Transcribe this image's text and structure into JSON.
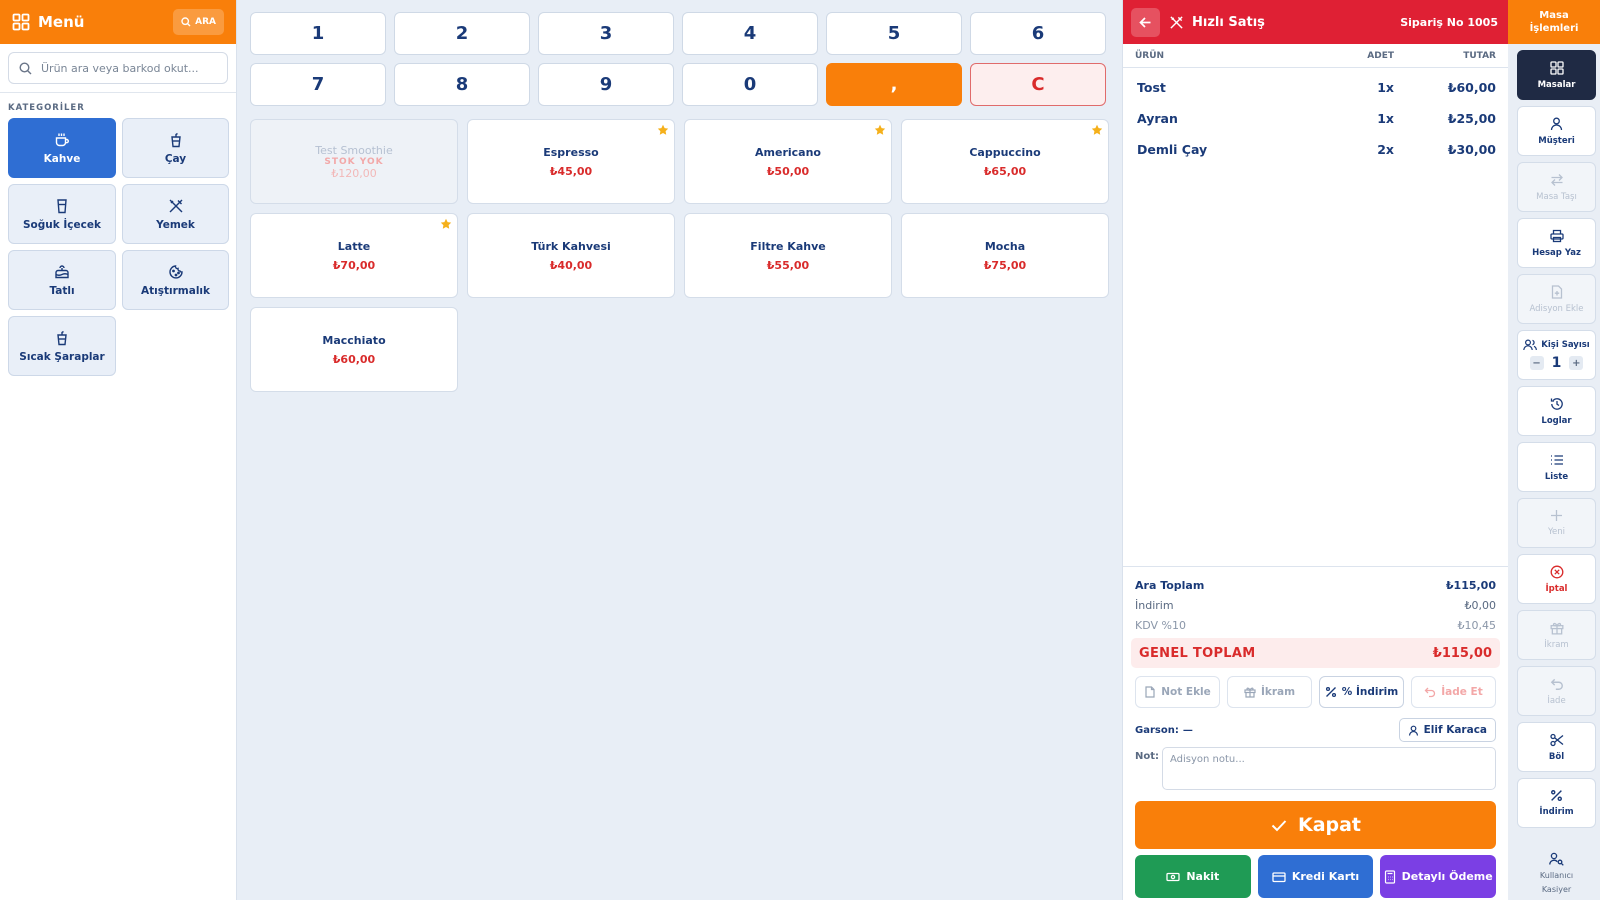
{
  "menu": {
    "title": "Menü",
    "search_button": "ARA",
    "search_placeholder": "Ürün ara veya barkod okut...",
    "categories_title": "KATEGORİLER",
    "categories": [
      {
        "label": "Kahve",
        "icon": "coffee-cup-icon",
        "active": true
      },
      {
        "label": "Çay",
        "icon": "tea-cup-icon",
        "active": false
      },
      {
        "label": "Soğuk İçecek",
        "icon": "cold-drink-icon",
        "active": false
      },
      {
        "label": "Yemek",
        "icon": "utensils-icon",
        "active": false
      },
      {
        "label": "Tatlı",
        "icon": "cake-icon",
        "active": false
      },
      {
        "label": "Atıştırmalık",
        "icon": "cookie-icon",
        "active": false
      },
      {
        "label": "Sıcak Şaraplar",
        "icon": "wine-cup-icon",
        "active": false
      }
    ]
  },
  "keypad": {
    "keys": [
      "1",
      "2",
      "3",
      "4",
      "5",
      "6",
      "7",
      "8",
      "9",
      "0",
      ",",
      "C"
    ]
  },
  "products": [
    {
      "name": "Test Smoothie",
      "price": "₺120,00",
      "stock_label": "STOK YOK",
      "out_of_stock": true,
      "favorite": false
    },
    {
      "name": "Espresso",
      "price": "₺45,00",
      "out_of_stock": false,
      "favorite": true
    },
    {
      "name": "Americano",
      "price": "₺50,00",
      "out_of_stock": false,
      "favorite": true
    },
    {
      "name": "Cappuccino",
      "price": "₺65,00",
      "out_of_stock": false,
      "favorite": true
    },
    {
      "name": "Latte",
      "price": "₺70,00",
      "out_of_stock": false,
      "favorite": true
    },
    {
      "name": "Türk Kahvesi",
      "price": "₺40,00",
      "out_of_stock": false,
      "favorite": false
    },
    {
      "name": "Filtre Kahve",
      "price": "₺55,00",
      "out_of_stock": false,
      "favorite": false
    },
    {
      "name": "Mocha",
      "price": "₺75,00",
      "out_of_stock": false,
      "favorite": false
    },
    {
      "name": "Macchiato",
      "price": "₺60,00",
      "out_of_stock": false,
      "favorite": false
    }
  ],
  "order": {
    "title": "Hızlı Satış",
    "order_no": "Sipariş No 1005",
    "col_product": "ÜRÜN",
    "col_qty": "ADET",
    "col_total": "TUTAR",
    "items": [
      {
        "name": "Tost",
        "qty": "1x",
        "total": "₺60,00"
      },
      {
        "name": "Ayran",
        "qty": "1x",
        "total": "₺25,00"
      },
      {
        "name": "Demli Çay",
        "qty": "2x",
        "total": "₺30,00"
      }
    ],
    "subtotal_label": "Ara Toplam",
    "subtotal": "₺115,00",
    "discount_label": "İndirim",
    "discount": "₺0,00",
    "vat_label": "KDV %10",
    "vat": "₺10,45",
    "grand_label": "GENEL TOPLAM",
    "grand_total": "₺115,00",
    "actions": {
      "note": "Not Ekle",
      "treat": "İkram",
      "discount": "% İndirim",
      "refund": "İade Et"
    },
    "waiter_label": "Garson:",
    "waiter_value": "—",
    "waiter_name": "Elif Karaca",
    "note_label": "Not:",
    "note_placeholder": "Adisyon notu...",
    "close_label": "Kapat",
    "pay_cash": "Nakit",
    "pay_card": "Kredi Kartı",
    "pay_detailed": "Detaylı Ödeme"
  },
  "tools": {
    "header_line1": "Masa",
    "header_line2": "İşlemleri",
    "items": {
      "tables": "Masalar",
      "customer": "Müşteri",
      "move_table": "Masa Taşı",
      "print_bill": "Hesap Yaz",
      "add_bill": "Adisyon Ekle",
      "guest_count_label": "Kişi Sayısı",
      "guest_count": "1",
      "logs": "Loglar",
      "list": "Liste",
      "new": "Yeni",
      "cancel": "İptal",
      "treat": "İkram",
      "refund": "İade",
      "split": "Böl",
      "discount": "İndirim"
    },
    "user_label": "Kullanıcı",
    "user_role": "Kasiyer"
  },
  "colors": {
    "orange": "#f97f0a",
    "red": "#df2034",
    "blue": "#2f6ed3",
    "navy": "#1a3a78",
    "green": "#1f9b55",
    "purple": "#7b3fe4"
  }
}
